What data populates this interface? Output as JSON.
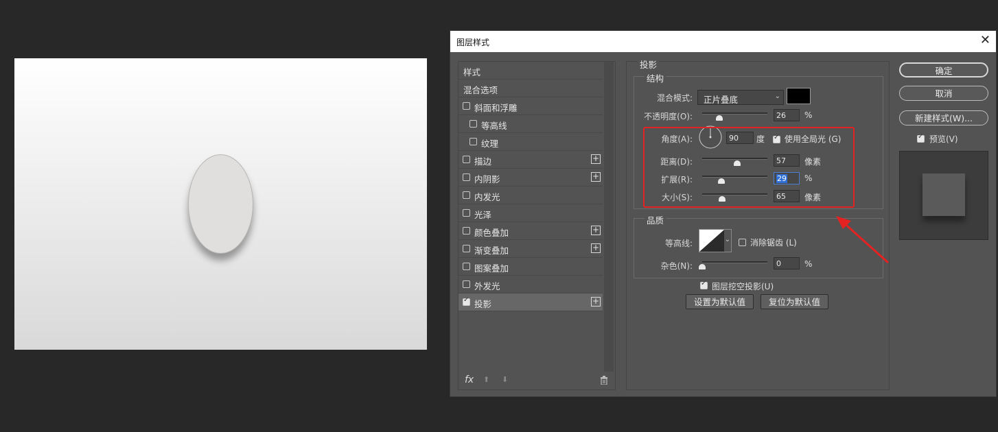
{
  "dialog": {
    "title": "图层样式",
    "close_glyph": "✕"
  },
  "left_panel": {
    "items": [
      {
        "label": "样式",
        "checkbox": null,
        "plus": false,
        "indent": false,
        "selected": false
      },
      {
        "label": "混合选项",
        "checkbox": null,
        "plus": false,
        "indent": false,
        "selected": false
      },
      {
        "label": "斜面和浮雕",
        "checkbox": false,
        "plus": false,
        "indent": false,
        "selected": false
      },
      {
        "label": "等高线",
        "checkbox": false,
        "plus": false,
        "indent": true,
        "selected": false
      },
      {
        "label": "纹理",
        "checkbox": false,
        "plus": false,
        "indent": true,
        "selected": false
      },
      {
        "label": "描边",
        "checkbox": false,
        "plus": true,
        "indent": false,
        "selected": false
      },
      {
        "label": "内阴影",
        "checkbox": false,
        "plus": true,
        "indent": false,
        "selected": false
      },
      {
        "label": "内发光",
        "checkbox": false,
        "plus": false,
        "indent": false,
        "selected": false
      },
      {
        "label": "光泽",
        "checkbox": false,
        "plus": false,
        "indent": false,
        "selected": false
      },
      {
        "label": "颜色叠加",
        "checkbox": false,
        "plus": true,
        "indent": false,
        "selected": false
      },
      {
        "label": "渐变叠加",
        "checkbox": false,
        "plus": true,
        "indent": false,
        "selected": false
      },
      {
        "label": "图案叠加",
        "checkbox": false,
        "plus": false,
        "indent": false,
        "selected": false
      },
      {
        "label": "外发光",
        "checkbox": false,
        "plus": false,
        "indent": false,
        "selected": false
      },
      {
        "label": "投影",
        "checkbox": true,
        "plus": true,
        "indent": false,
        "selected": true
      }
    ],
    "bottom_icons": [
      "fx-icon",
      "arrow-up-icon",
      "arrow-down-icon",
      "trash-icon"
    ],
    "fx_label": "fx"
  },
  "shadow": {
    "section_title": "投影",
    "structure": {
      "legend": "结构",
      "blend_mode_label": "混合模式:",
      "blend_mode_value": "正片叠底",
      "blend_color": "#000000",
      "opacity_label": "不透明度(O):",
      "opacity_value": "26",
      "opacity_unit": "%",
      "opacity_fraction": 0.26,
      "angle_label": "角度(A):",
      "angle_value": "90",
      "angle_unit": "度",
      "global_light_label": "使用全局光 (G)",
      "global_light_checked": true,
      "distance_label": "距离(D):",
      "distance_value": "57",
      "distance_unit": "像素",
      "distance_fraction": 0.54,
      "spread_label": "扩展(R):",
      "spread_value": "29",
      "spread_unit": "%",
      "spread_fraction": 0.29,
      "size_label": "大小(S):",
      "size_value": "65",
      "size_unit": "像素",
      "size_fraction": 0.3
    },
    "quality": {
      "legend": "品质",
      "contour_label": "等高线:",
      "antialias_label": "消除锯齿 (L)",
      "antialias_checked": false,
      "noise_label": "杂色(N):",
      "noise_value": "0",
      "noise_unit": "%",
      "noise_fraction": 0
    },
    "knockout_label": "图层挖空投影(U)",
    "knockout_checked": true,
    "set_default_button": "设置为默认值",
    "reset_default_button": "复位为默认值"
  },
  "right_buttons": {
    "ok": "确定",
    "cancel": "取消",
    "new_style": "新建样式(W)...",
    "preview_label": "预览(V)",
    "preview_checked": true
  },
  "annotation": {
    "highlight_color": "#e52222"
  }
}
